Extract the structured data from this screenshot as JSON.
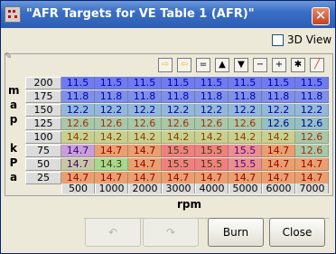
{
  "window": {
    "title": "\"AFR Targets for VE Table 1 (AFR)\"",
    "close_glyph": "✕"
  },
  "view3d": {
    "label": "3D View",
    "checked": false
  },
  "toolbar": {
    "buttons": [
      {
        "name": "paste-right-button",
        "glyph": "⇨",
        "color": "#f1c40f"
      },
      {
        "name": "paste-left-button",
        "glyph": "⇦",
        "color": "#f1c40f"
      },
      {
        "name": "set-equal-button",
        "glyph": "="
      },
      {
        "name": "increment-button",
        "glyph": "▲"
      },
      {
        "name": "decrement-button",
        "glyph": "▼"
      },
      {
        "name": "minus-button",
        "glyph": "−"
      },
      {
        "name": "plus-button",
        "glyph": "+"
      },
      {
        "name": "multiply-button",
        "glyph": "✱"
      },
      {
        "name": "interpolate-button",
        "glyph": "╱",
        "color": "#c0392b"
      }
    ]
  },
  "axes": {
    "y_label_letters": [
      "m",
      "a",
      "p",
      "",
      "k",
      "P",
      "a"
    ],
    "x_label": "rpm",
    "rows": [
      "200",
      "175",
      "150",
      "125",
      "100",
      "75",
      "50",
      "25"
    ],
    "cols": [
      "500",
      "1000",
      "2000",
      "3000",
      "4000",
      "5000",
      "6000",
      "7000"
    ]
  },
  "table": [
    [
      "11.5",
      "11.5",
      "11.5",
      "11.5",
      "11.5",
      "11.5",
      "11.5",
      "11.5"
    ],
    [
      "11.8",
      "11.8",
      "11.8",
      "11.8",
      "11.8",
      "11.8",
      "11.8",
      "11.8"
    ],
    [
      "12.2",
      "12.2",
      "12.2",
      "12.2",
      "12.2",
      "12.2",
      "12.2",
      "12.2"
    ],
    [
      "12.6",
      "12.6",
      "12.6",
      "12.6",
      "12.6",
      "12.6",
      "12.6",
      "12.6"
    ],
    [
      "14.2",
      "14.2",
      "14.2",
      "14.2",
      "14.2",
      "14.2",
      "14.2",
      "12.6"
    ],
    [
      "14.7",
      "14.7",
      "14.7",
      "15.5",
      "15.5",
      "15.5",
      "14.7",
      "12.6"
    ],
    [
      "14.7",
      "14.3",
      "14.7",
      "15.5",
      "15.5",
      "15.5",
      "14.7",
      "14.7"
    ],
    [
      "14.7",
      "14.7",
      "14.7",
      "14.7",
      "14.7",
      "14.7",
      "14.7",
      "14.7"
    ]
  ],
  "colors": {
    "11.5": "#6e7cf0",
    "11.8": "#8090e8",
    "12.2": "#94b8d8",
    "12.6": "#a8c8a8",
    "14.2": "#c8d090",
    "14.3": "#a8d890",
    "14.7": "#e8a070",
    "15.5": "#f08080"
  },
  "text_colors": {
    "11.5": "#0000b0",
    "11.8": "#0000b0",
    "12.2": "#0000b0",
    "12.6": "#a03010",
    "14.2": "#8a4000",
    "14.3": "#404000",
    "14.7": "#a00000",
    "15.5": "#404000"
  },
  "special_cells": [
    {
      "r": 3,
      "c": 6,
      "bg": "#94c0c0",
      "fg": "#0000b0"
    },
    {
      "r": 3,
      "c": 7,
      "bg": "#94c0c0",
      "fg": "#0000b0"
    },
    {
      "r": 5,
      "c": 0,
      "bg": "#c8a0d8",
      "fg": "#400080"
    },
    {
      "r": 6,
      "c": 0,
      "bg": "#c8c8a0",
      "fg": "#400080"
    },
    {
      "r": 6,
      "c": 2,
      "bg": "#e8a070",
      "fg": "#a00000"
    },
    {
      "r": 5,
      "c": 5,
      "bg": "#e89090",
      "fg": "#600080"
    },
    {
      "r": 6,
      "c": 5,
      "bg": "#e89090",
      "fg": "#600080"
    }
  ],
  "buttons": {
    "undo_label": "↶",
    "redo_label": "↷",
    "burn_label": "Burn",
    "close_label": "Close"
  }
}
